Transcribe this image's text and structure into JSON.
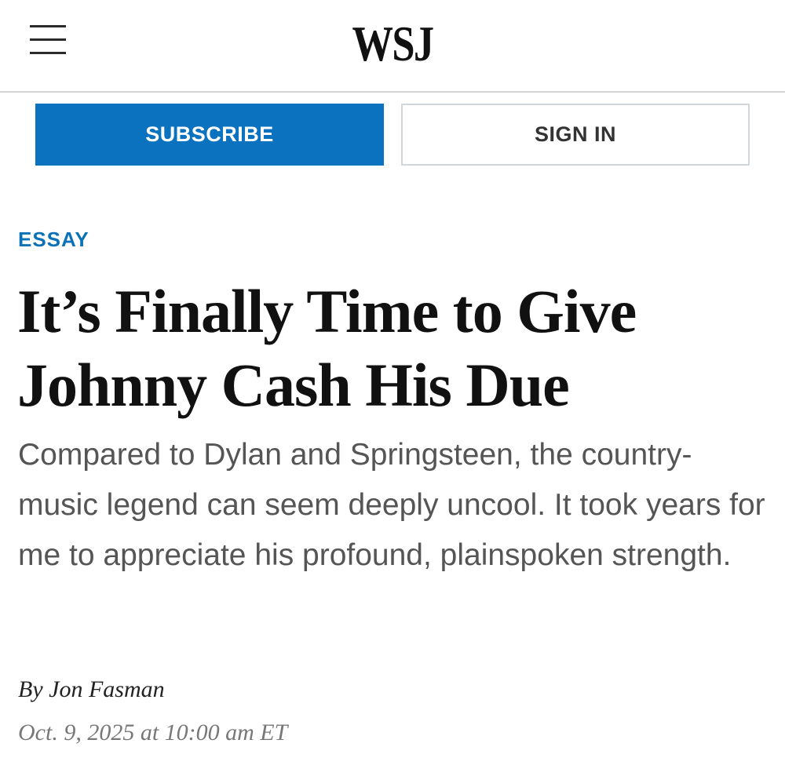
{
  "header": {
    "logo_text": "WSJ",
    "menu_icon": "hamburger-menu-icon"
  },
  "actions": {
    "subscribe_label": "SUBSCRIBE",
    "signin_label": "SIGN IN",
    "subscribe_color": "#0a72bf"
  },
  "article": {
    "kicker": "ESSAY",
    "kicker_color": "#0b72b8",
    "headline": "It’s Finally Time to Give Johnny Cash His Due",
    "dek": "Compared to Dylan and Springsteen, the country-music legend can seem deeply uncool. It took years for me to appreciate his profound, plainspoken strength.",
    "byline_prefix": "By",
    "author": "Jon Fasman",
    "timestamp": "Oct. 9, 2025 at 10:00 am ET"
  }
}
